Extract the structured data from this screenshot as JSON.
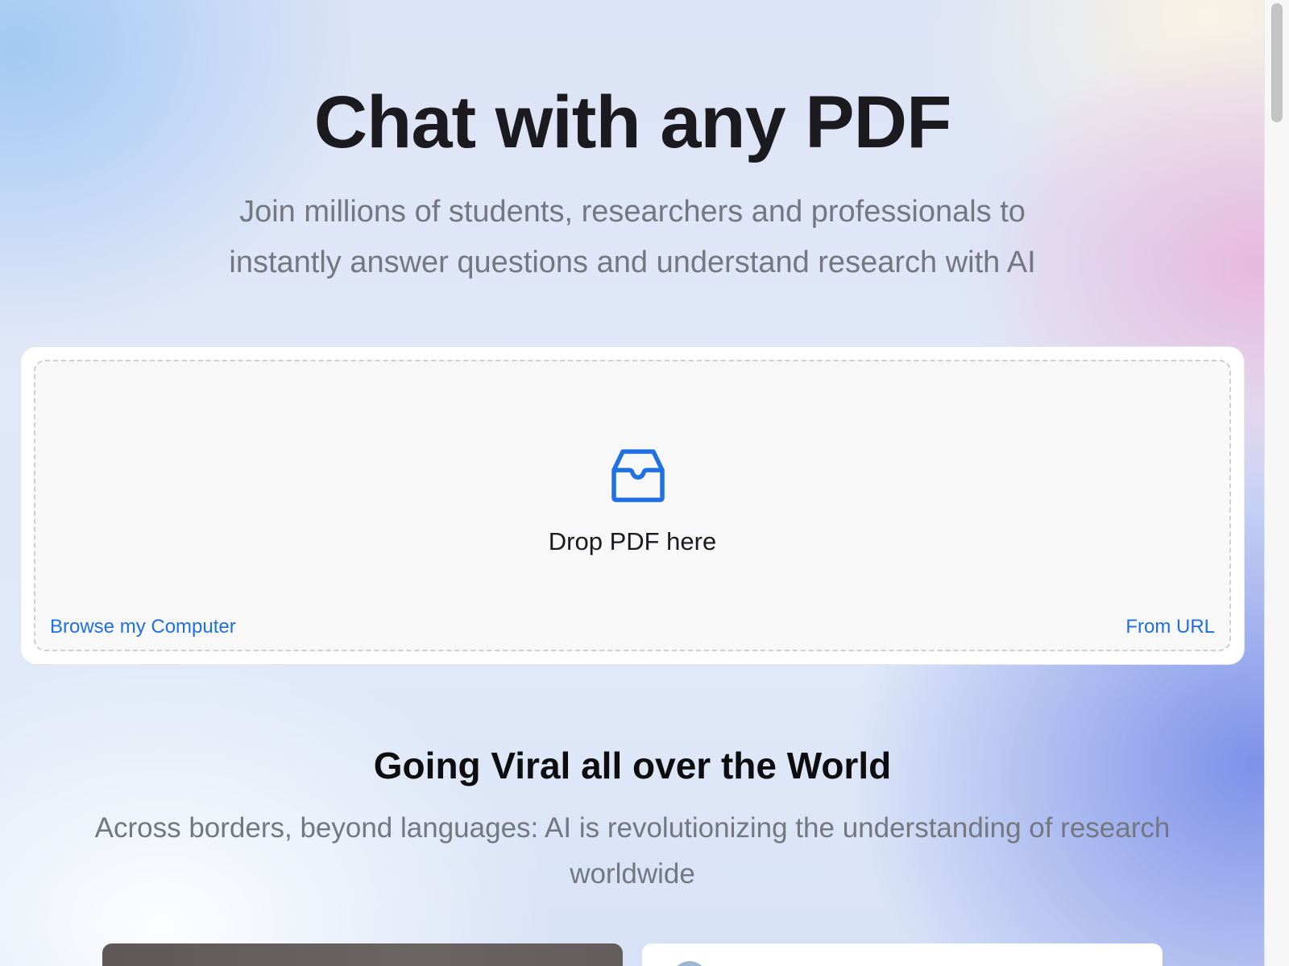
{
  "hero": {
    "title": "Chat with any PDF",
    "subtitle": "Join millions of students, researchers and professionals to instantly answer questions and understand research with AI"
  },
  "upload": {
    "icon": "inbox-icon",
    "drop_label": "Drop PDF here",
    "browse_label": "Browse my Computer",
    "url_label": "From URL"
  },
  "viral": {
    "title": "Going Viral all over the World",
    "subtitle": "Across borders, beyond languages: AI is revolutionizing the understanding of research worldwide"
  },
  "colors": {
    "accent": "#1f6fe5",
    "heading": "#1b1b1f",
    "muted": "#737780"
  }
}
